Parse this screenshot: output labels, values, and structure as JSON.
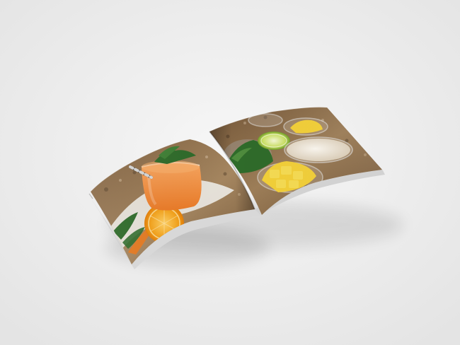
{
  "scene": {
    "description_visible_text": "",
    "colors": {
      "background": "#ececec",
      "paper_edge": "#d9d9d9",
      "granite": "#8a6a44",
      "orange_drink": "#f08b3a",
      "orange_fruit": "#f4a21a",
      "mango": "#f2cf38",
      "lime": "#c9df62",
      "cream": "#eee6d6",
      "greens": "#2f6b2a"
    },
    "objects": [
      "open-photo-book",
      "left-page-smoothie-glass",
      "left-page-orange-slice",
      "left-page-carrots",
      "right-page-herbs-bowl",
      "right-page-lime-slice",
      "right-page-yogurt-bowl",
      "right-page-mango-bowl"
    ]
  }
}
